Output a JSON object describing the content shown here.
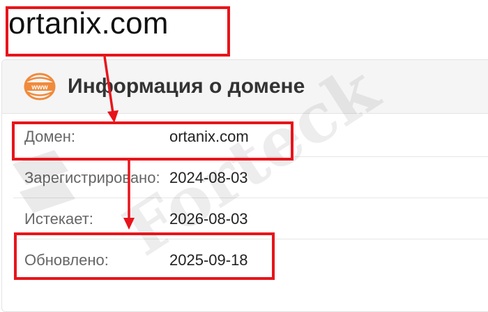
{
  "heading": "ortanix.com",
  "panel": {
    "title": "Информация о домене",
    "icon": "www-globe-icon",
    "icon_text": "www"
  },
  "rows": [
    {
      "label": "Домен:",
      "value": "ortanix.com"
    },
    {
      "label": "Зарегистрировано:",
      "value": "2024-08-03"
    },
    {
      "label": "Истекает:",
      "value": "2026-08-03"
    },
    {
      "label": "Обновлено:",
      "value": "2025-09-18"
    }
  ],
  "watermark": "Forteck",
  "colors": {
    "annotation": "#e8141b",
    "icon_accent": "#f08a3c",
    "header_bg": "#f5f5f5"
  }
}
